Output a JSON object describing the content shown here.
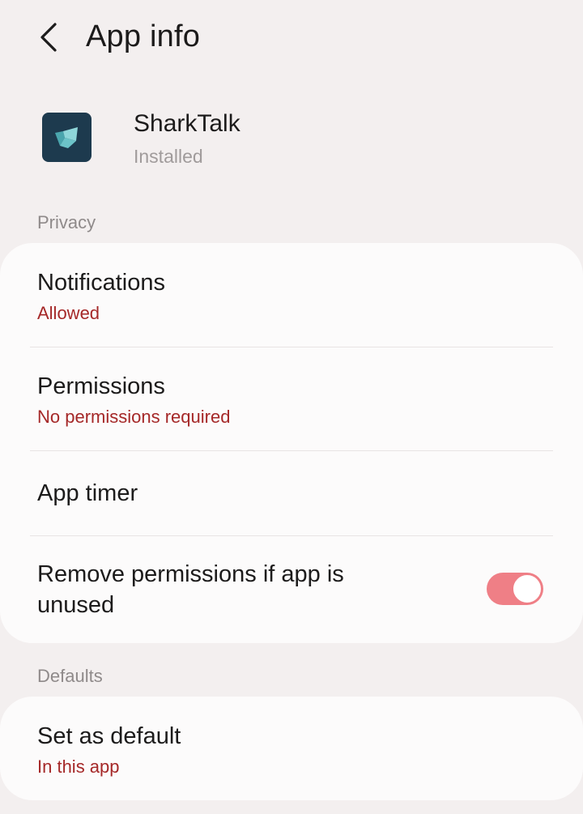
{
  "header": {
    "title": "App info",
    "back_icon": "chevron-left-icon"
  },
  "app": {
    "name": "SharkTalk",
    "status": "Installed",
    "icon": "sharktalk-app-icon",
    "icon_bg": "#1d3a4e",
    "icon_fg": "#6cc3c8"
  },
  "privacy": {
    "section_label": "Privacy",
    "items": [
      {
        "title": "Notifications",
        "subtitle": "Allowed"
      },
      {
        "title": "Permissions",
        "subtitle": "No permissions required"
      },
      {
        "title": "App timer"
      },
      {
        "title": "Remove permissions if app is unused",
        "toggle_on": true
      }
    ]
  },
  "defaults": {
    "section_label": "Defaults",
    "items": [
      {
        "title": "Set as default",
        "subtitle": "In this app"
      }
    ]
  },
  "colors": {
    "background": "#f3efef",
    "card": "#fcfbfb",
    "accent_text": "#a52828",
    "toggle_on": "#ef7f86",
    "secondary_text": "#8f8a8a"
  }
}
